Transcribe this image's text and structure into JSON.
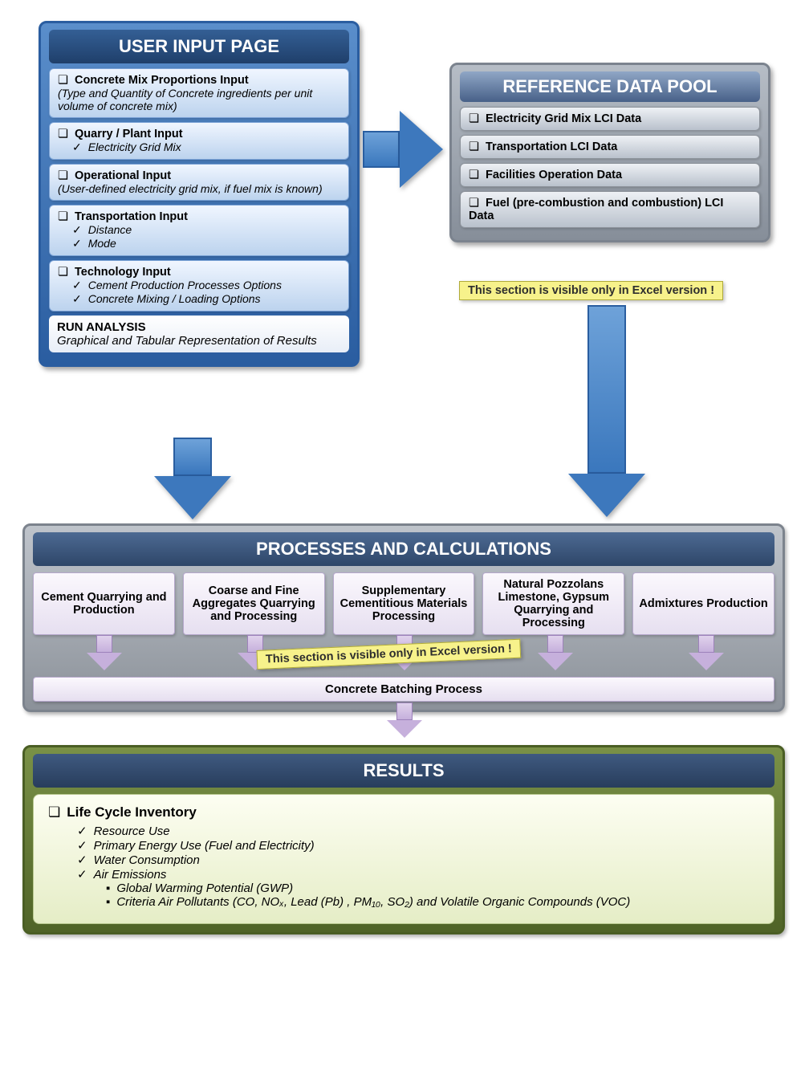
{
  "userInput": {
    "title": "USER INPUT PAGE",
    "items": [
      {
        "title": "Concrete Mix Proportions Input",
        "desc": "(Type and Quantity of Concrete ingredients per unit volume of concrete mix)"
      },
      {
        "title": "Quarry / Plant Input",
        "subs": [
          "Electricity Grid Mix"
        ]
      },
      {
        "title": "Operational Input",
        "desc": "(User-defined electricity grid mix, if fuel mix is known)"
      },
      {
        "title": "Transportation Input",
        "subs": [
          "Distance",
          "Mode"
        ]
      },
      {
        "title": "Technology Input",
        "subs": [
          "Cement Production Processes Options",
          "Concrete Mixing / Loading Options"
        ]
      }
    ],
    "run": {
      "label": "RUN ANALYSIS",
      "desc": "Graphical and Tabular Representation of Results"
    }
  },
  "reference": {
    "title": "REFERENCE DATA POOL",
    "items": [
      "Electricity Grid Mix LCI Data",
      "Transportation LCI Data",
      "Facilities Operation Data",
      "Fuel (pre-combustion and combustion) LCI Data"
    ]
  },
  "note": "This section is visible only in Excel version !",
  "processes": {
    "title": "PROCESSES AND CALCULATIONS",
    "boxes": [
      "Cement Quarrying and Production",
      "Coarse and Fine Aggregates Quarrying and Processing",
      "Supplementary Cementitious Materials Processing",
      "Natural Pozzolans Limestone, Gypsum Quarrying and Processing",
      "Admixtures Production"
    ],
    "batching": "Concrete Batching Process"
  },
  "results": {
    "title": "RESULTS",
    "heading": "Life Cycle Inventory",
    "subs1": [
      "Resource Use",
      "Primary Energy Use (Fuel and Electricity)",
      "Water Consumption",
      "Air Emissions"
    ],
    "subs2": [
      "Global Warming Potential (GWP)",
      "Criteria Air Pollutants (CO, NOₓ, Lead (Pb) , PM₁₀, SO₂) and Volatile Organic Compounds (VOC)"
    ]
  }
}
